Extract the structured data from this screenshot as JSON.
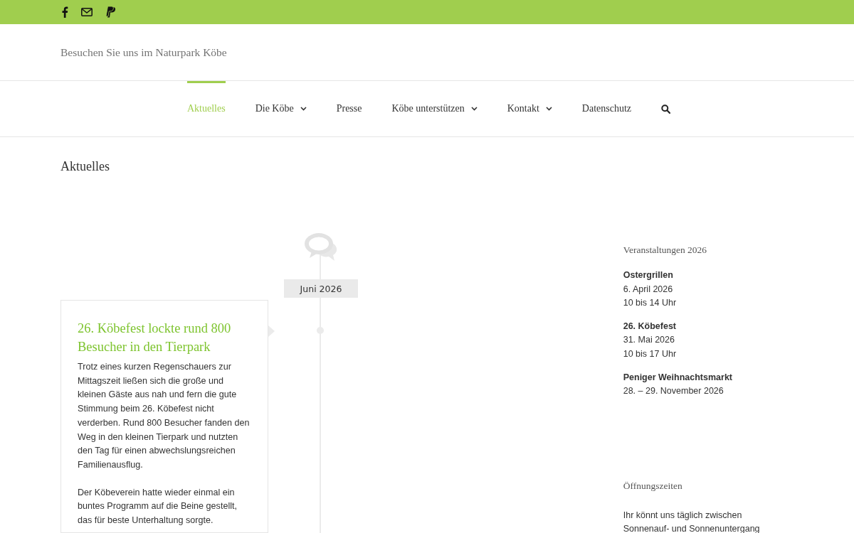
{
  "top_bar": {
    "social": [
      {
        "kind": "facebook"
      },
      {
        "kind": "mail"
      },
      {
        "kind": "paypal"
      }
    ]
  },
  "header": {
    "tagline": "Besuchen Sie uns im Naturpark Köbe"
  },
  "nav": {
    "items": [
      {
        "label": "Aktuelles",
        "selected": true,
        "dropdown": false
      },
      {
        "label": "Die Köbe",
        "selected": false,
        "dropdown": true
      },
      {
        "label": "Presse",
        "selected": false,
        "dropdown": false
      },
      {
        "label": "Köbe unterstützen",
        "selected": false,
        "dropdown": true
      },
      {
        "label": "Kontakt",
        "selected": false,
        "dropdown": true
      },
      {
        "label": "Datenschutz",
        "selected": false,
        "dropdown": false
      }
    ],
    "search": true
  },
  "page_title": "Aktuelles",
  "timeline": {
    "date_label": "Juni 2026",
    "post": {
      "title": "26. Köbefest lockte rund 800 Besucher in den Tierpark",
      "paragraphs": [
        "Trotz eines kurzen Regenschauers zur Mittagszeit ließen sich die große und kleinen Gäste aus nah und fern die gute Stimmung beim 26. Köbefest nicht verderben. Rund 800 Besucher fanden den Weg in den kleinen Tierpark und nutzten den Tag für einen abwechslungsreichen Familienausflug.",
        "Der Köbeverein hatte wieder einmal ein buntes Programm auf die Beine gestellt, das für beste Unterhaltung sorgte."
      ]
    }
  },
  "sidebar": {
    "events_heading": "Veranstaltungen 2026",
    "events": [
      {
        "name": "Ostergrillen",
        "lines": [
          "6. April 2026",
          "10 bis 14 Uhr"
        ]
      },
      {
        "name": "26. Köbefest",
        "lines": [
          "31. Mai 2026",
          "10 bis 17 Uhr"
        ]
      },
      {
        "name": "Peniger Weihnachtsmarkt",
        "lines": [
          "28. – 29. November 2026"
        ]
      }
    ],
    "hours_heading": "Öffnungszeiten",
    "hours_text": "Ihr könnt uns täglich zwischen Sonnenauf- und Sonnenuntergang"
  }
}
